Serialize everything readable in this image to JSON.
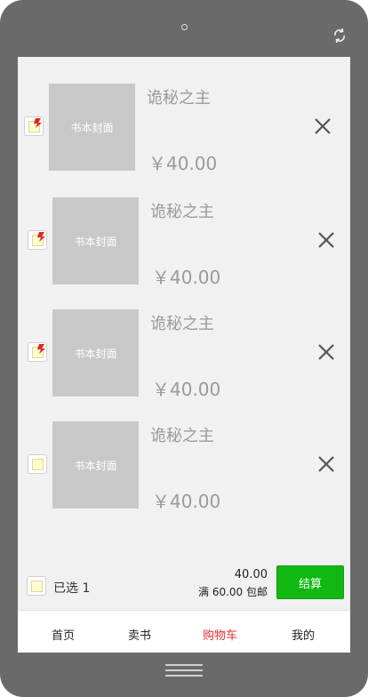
{
  "cart": {
    "items": [
      {
        "cover_text": "书本封面",
        "title": "诡秘之主",
        "price": "￥40.00",
        "checked": true
      },
      {
        "cover_text": "书本封面",
        "title": "诡秘之主",
        "price": "￥40.00",
        "checked": true
      },
      {
        "cover_text": "书本封面",
        "title": "诡秘之主",
        "price": "￥40.00",
        "checked": true
      },
      {
        "cover_text": "书本封面",
        "title": "诡秘之主",
        "price": "￥40.00",
        "checked": false
      }
    ]
  },
  "footer": {
    "selected_label": "已选 1",
    "total": "40.00",
    "shipping_note": "满 60.00 包邮",
    "checkout_label": "结算"
  },
  "tabbar": {
    "tabs": [
      {
        "label": "首页",
        "active": false
      },
      {
        "label": "卖书",
        "active": false
      },
      {
        "label": "购物车",
        "active": true
      },
      {
        "label": "我的",
        "active": false
      }
    ]
  },
  "colors": {
    "accent_green": "#11b813",
    "active_tab": "#e53030",
    "device_frame": "#6a6a6a",
    "screen_bg": "#f1f1f1"
  }
}
